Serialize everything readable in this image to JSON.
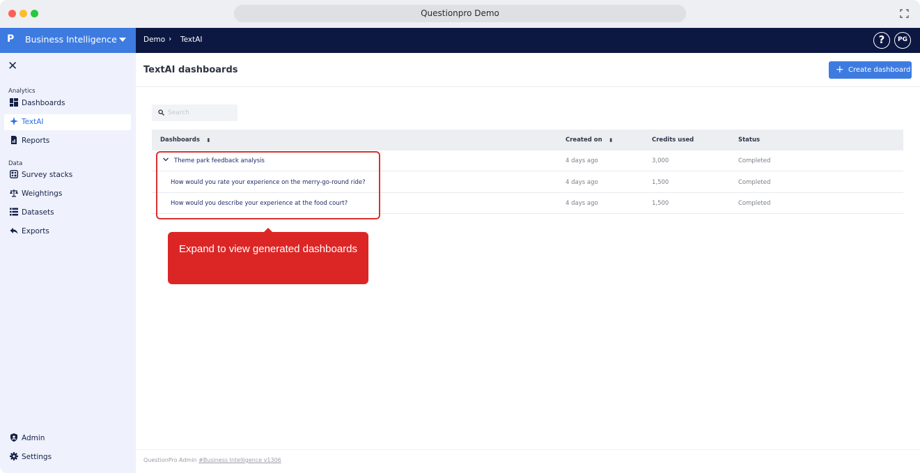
{
  "window": {
    "title": "Questionpro Demo"
  },
  "brand": {
    "logo": "P",
    "name": "Business Intelligence"
  },
  "breadcrumb": [
    "Demo",
    "TextAI"
  ],
  "topbar": {
    "help": "?",
    "avatar": "PG"
  },
  "sidebar": {
    "sections": {
      "analytics": "Analytics",
      "data": "Data"
    },
    "items": [
      {
        "label": "Dashboards",
        "icon": "dashboard-icon"
      },
      {
        "label": "TextAI",
        "icon": "sparkle-icon",
        "active": true
      },
      {
        "label": "Reports",
        "icon": "report-icon"
      },
      {
        "label": "Survey stacks",
        "icon": "survey-stacks-icon"
      },
      {
        "label": "Weightings",
        "icon": "scale-icon"
      },
      {
        "label": "Datasets",
        "icon": "list-icon"
      },
      {
        "label": "Exports",
        "icon": "share-icon"
      }
    ],
    "bottom_items": [
      {
        "label": "Admin",
        "icon": "shield-icon"
      },
      {
        "label": "Settings",
        "icon": "gear-icon"
      }
    ]
  },
  "main": {
    "title": "TextAI dashboards",
    "create_button": "Create dashboard",
    "search_placeholder": "Search"
  },
  "table": {
    "columns": [
      "Dashboards",
      "Created on",
      "Credits used",
      "Status"
    ],
    "rows": [
      {
        "name": "Theme park feedback analysis",
        "created": "4 days ago",
        "credits": "3,000",
        "status": "Completed",
        "expandable": true
      },
      {
        "name": "How would you rate your experience on the merry-go-round ride?",
        "created": "4 days ago",
        "credits": "1,500",
        "status": "Completed"
      },
      {
        "name": "How would you describe your experience at the food court?",
        "created": "4 days ago",
        "credits": "1,500",
        "status": "Completed"
      }
    ]
  },
  "tooltip": {
    "text": "Expand to view generated dashboards"
  },
  "footer": {
    "prefix": "QuestionPro Admin",
    "link": "#Business Intelligence v1306"
  },
  "colors": {
    "accent": "#3d7be1",
    "navbar": "#0c1742",
    "highlight": "#dc2626"
  }
}
